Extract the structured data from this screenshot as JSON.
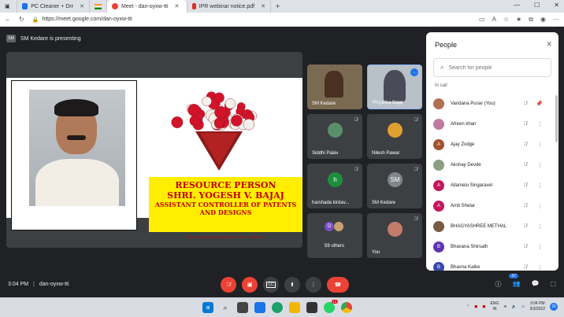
{
  "browser": {
    "tabs": [
      {
        "label": "PC Cleaner + Driver Updater",
        "fav": "#1a73e8",
        "active": false
      },
      {
        "label": "Meet - dan-oyxw-tti",
        "fav": "#ea4335",
        "active": true
      },
      {
        "label": "IPR webinar notice.pdf",
        "fav": "#d93025",
        "active": false
      }
    ],
    "new_tab": "+",
    "url": "https://meet.google.com/dan-oyxw-tti"
  },
  "meeting": {
    "presenting_text": "SM Kedare is presenting",
    "presenter_initials": "SM",
    "time": "3:04 PM",
    "separator": "|",
    "code": "dan-oyxw-tti"
  },
  "slide": {
    "line1": "RESOURCE PERSON",
    "line2": "SHRI. YOGESH V. BAJAJ",
    "line3": "ASSISTANT CONTROLLER OF PATENTS",
    "line4": "AND DESIGNS",
    "credit": "PROF. SHRINIWAS KEDARE DEPT. OF COMMERCE"
  },
  "tiles": [
    {
      "name": "SM Kedare",
      "kind": "video",
      "color": "#8a6a4c"
    },
    {
      "name": "Priyanka Bajaj",
      "kind": "video",
      "color": "#9aa6b2"
    },
    {
      "name": "Siddhi Palav",
      "kind": "avatar",
      "initial": "",
      "color": "#5a8f6a"
    },
    {
      "name": "Nilesh Pawar",
      "kind": "avatar",
      "initial": "",
      "color": "#e0a030"
    },
    {
      "name": "harshada kirdav...",
      "kind": "avatar",
      "initial": "h",
      "color": "#1e8e3e"
    },
    {
      "name": "SM Kedare",
      "kind": "avatar",
      "initial": "SM",
      "color": "#80868b"
    },
    {
      "name": "59 others",
      "kind": "others",
      "initial": "D",
      "color": "#7b4fc4"
    },
    {
      "name": "You",
      "kind": "avatar",
      "initial": "",
      "color": "#c47b6a"
    }
  ],
  "people_panel": {
    "title": "People",
    "search_placeholder": "Search for people",
    "section": "In call",
    "participants": [
      {
        "name": "Vandana Purav (You)",
        "initial": "",
        "color": "#b07050"
      },
      {
        "name": "Afreen khan",
        "initial": "",
        "color": "#c07aa0"
      },
      {
        "name": "Ajay Zodge",
        "initial": "A",
        "color": "#a0522d"
      },
      {
        "name": "Akshay Devde",
        "initial": "",
        "color": "#8aa080"
      },
      {
        "name": "Allamelu Singaravel",
        "initial": "A",
        "color": "#c2185b"
      },
      {
        "name": "Amit Shelar",
        "initial": "A",
        "color": "#c2185b"
      },
      {
        "name": "BHAGYASHREE METHAL",
        "initial": "",
        "color": "#7a5a40"
      },
      {
        "name": "Bhavana Shirsath",
        "initial": "B",
        "color": "#5e35b1"
      },
      {
        "name": "Bhavna Katke",
        "initial": "B",
        "color": "#3949ab"
      }
    ]
  },
  "bottom_bar": {
    "people_count": "67"
  },
  "taskbar": {
    "lang1": "ENG",
    "lang2": "IN",
    "clock_time": "3:04 PM",
    "clock_date": "3/3/2022",
    "notif_count": "20",
    "whatsapp_badge": "13"
  }
}
